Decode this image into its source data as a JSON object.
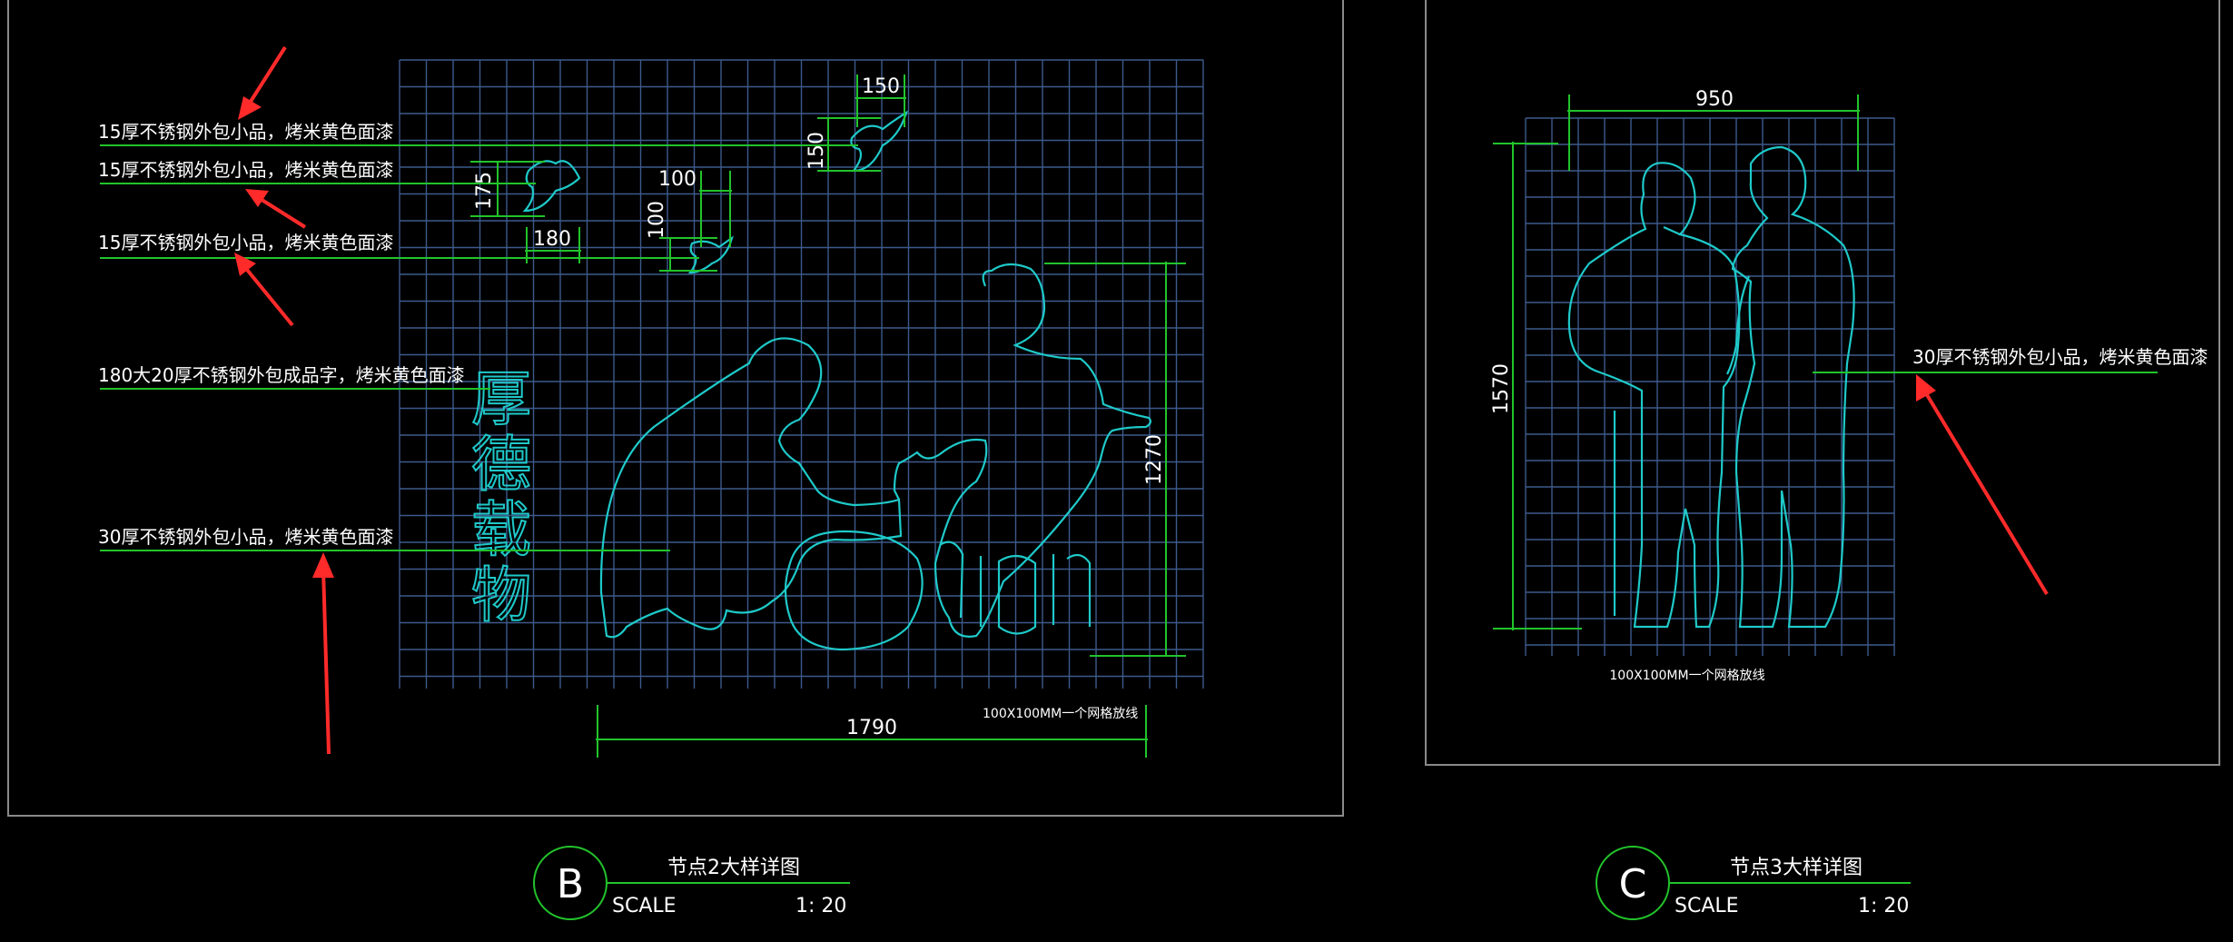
{
  "drawing_b": {
    "notes": [
      "15厚不锈钢外包小品，烤米黄色面漆",
      "15厚不锈钢外包小品，烤米黄色面漆",
      "15厚不锈钢外包小品，烤米黄色面漆",
      "180大20厚不锈钢外包成品字，烤米黄色面漆",
      "30厚不锈钢外包小品，烤米黄色面漆"
    ],
    "dimensions": {
      "bird1_w": "150",
      "bird1_h": "150",
      "bird2_h": "175",
      "bird2_w": "180",
      "bird3_w": "100",
      "bird3_h": "100",
      "height": "1270",
      "width": "1790"
    },
    "characters": [
      "厚",
      "德",
      "载",
      "物"
    ],
    "grid_note": "100X100MM一个网格放线",
    "title": "节点2大样详图",
    "label": "B",
    "scale_label": "SCALE",
    "scale_value": "1: 20"
  },
  "drawing_c": {
    "dimensions": {
      "width": "950",
      "height": "1570"
    },
    "note": "30厚不锈钢外包小品，烤米黄色面漆",
    "grid_note": "100X100MM一个网格放线",
    "title": "节点3大样详图",
    "label": "C",
    "scale_label": "SCALE",
    "scale_value": "1: 20"
  },
  "colors": {
    "background": "#000000",
    "grid": "#3d5a8c",
    "dimension_lines": "#22c32b",
    "outline": "#1fc9c9",
    "annotation_arrows": "#ff2a2a",
    "text": "#ffffff"
  }
}
